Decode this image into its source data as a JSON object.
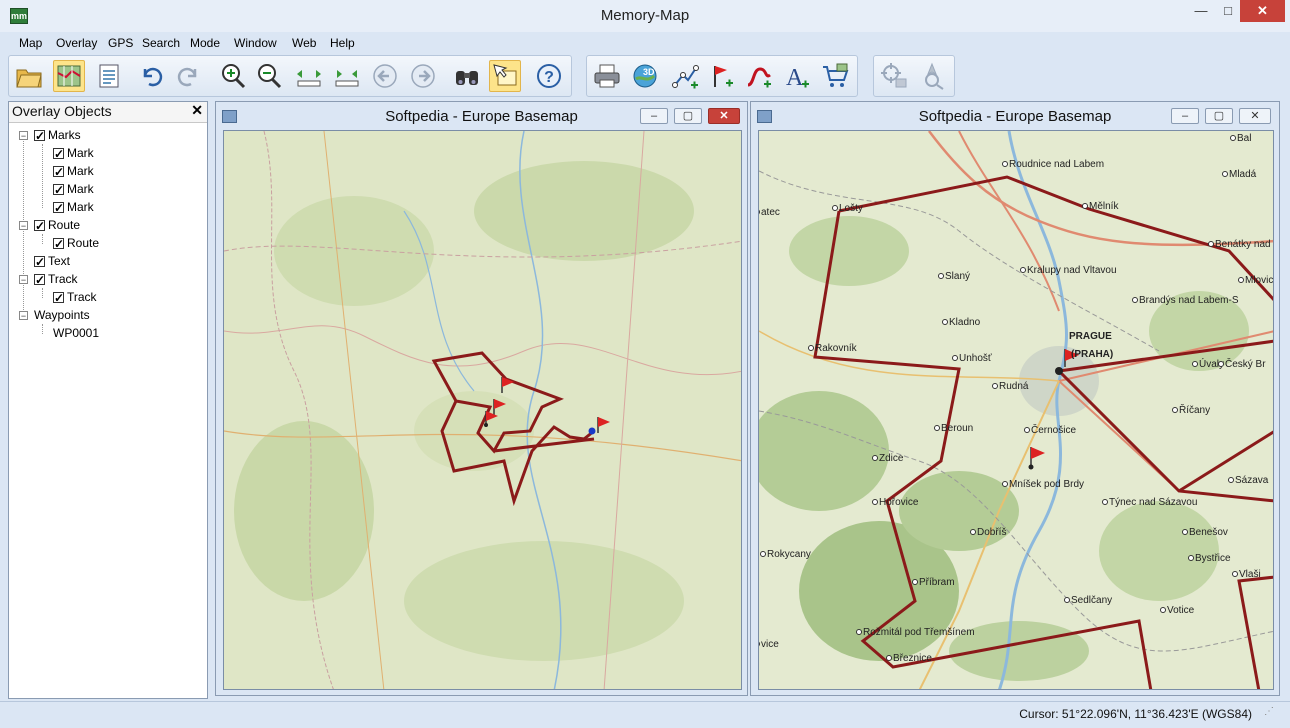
{
  "app": {
    "title": "Memory-Map",
    "icon": "map-app-icon",
    "icon_label": "mm",
    "controls": {
      "minimize": "—",
      "maximize": "□",
      "close": "✕"
    }
  },
  "menu": {
    "items": [
      "Map",
      "Overlay",
      "GPS",
      "Search",
      "Mode",
      "Window",
      "Web",
      "Help"
    ]
  },
  "toolbar": {
    "buttons": [
      {
        "icon": "open-folder-icon"
      },
      {
        "icon": "map-view-icon",
        "active": true
      },
      {
        "icon": "overlay-list-icon"
      },
      {
        "icon": "undo-icon"
      },
      {
        "icon": "redo-icon"
      },
      {
        "icon": "zoom-in-icon"
      },
      {
        "icon": "zoom-out-icon"
      },
      {
        "icon": "scale-up-icon"
      },
      {
        "icon": "scale-down-icon"
      },
      {
        "icon": "back-icon"
      },
      {
        "icon": "forward-icon"
      },
      {
        "icon": "binoculars-icon"
      },
      {
        "icon": "select-pointer-icon",
        "active": true
      },
      {
        "icon": "help-icon"
      },
      {
        "icon": "print-icon"
      },
      {
        "icon": "3d-view-icon"
      },
      {
        "icon": "new-route-icon"
      },
      {
        "icon": "new-mark-icon"
      },
      {
        "icon": "new-track-icon"
      },
      {
        "icon": "new-text-icon"
      },
      {
        "icon": "shop-cart-icon"
      },
      {
        "icon": "lock-position-icon"
      },
      {
        "icon": "gps-navigate-icon"
      }
    ]
  },
  "overlay_panel": {
    "title": "Overlay Objects",
    "close": "✕",
    "tree": [
      {
        "label": "Marks",
        "checked": true,
        "children": [
          "Mark",
          "Mark",
          "Mark",
          "Mark"
        ]
      },
      {
        "label": "Route",
        "checked": true,
        "children": [
          "Route"
        ]
      },
      {
        "label": "Text",
        "checked": true,
        "children": []
      },
      {
        "label": "Track",
        "checked": true,
        "children": [
          "Track"
        ]
      },
      {
        "label": "Waypoints",
        "checked": false,
        "children": [
          "WP0001"
        ]
      }
    ]
  },
  "map_windows": [
    {
      "title": "Softpedia - Europe Basemap",
      "controls": {
        "minimize": "–",
        "restore": "▢",
        "close": "✕"
      }
    },
    {
      "title": "Softpedia - Europe Basemap",
      "controls": {
        "minimize": "–",
        "restore": "▢",
        "close": "✕"
      }
    }
  ],
  "map_right": {
    "places": [
      "Roudnice nad Labem",
      "Mělník",
      "Lošty",
      "Benátky nad",
      "Mladá",
      "Bal",
      "Slaný",
      "Kralupy nad Vltavou",
      "Brandýs nad Labem-S",
      "Mlovic",
      "Kladno",
      "PRAGUE",
      "(PRAHA)",
      "Rakovník",
      "Unhošť",
      "Úvaly",
      "Český Br",
      "Rudná",
      "Říčany",
      "Beroun",
      "Černošice",
      "Zdice",
      "Mníšek pod Brdy",
      "Hořovice",
      "Týnec nad Sázavou",
      "Sázava",
      "Dobříš",
      "Benešov",
      "Rokycany",
      "Bystřice",
      "Příbram",
      "Vlaši",
      "Sedlčany",
      "Votice",
      "Rožmitál pod Třemšínem",
      "Březnice",
      "atec",
      "vice"
    ]
  },
  "status": {
    "cursor": "Cursor: 51°22.096'N, 11°36.423'E (WGS84)",
    "grip": "⋰"
  },
  "colors": {
    "route": "#8b1a1a",
    "map_bg": "#e4ead0",
    "forest": "#b4cc96",
    "water": "#8cb8dc",
    "accent": "#fde48a"
  }
}
